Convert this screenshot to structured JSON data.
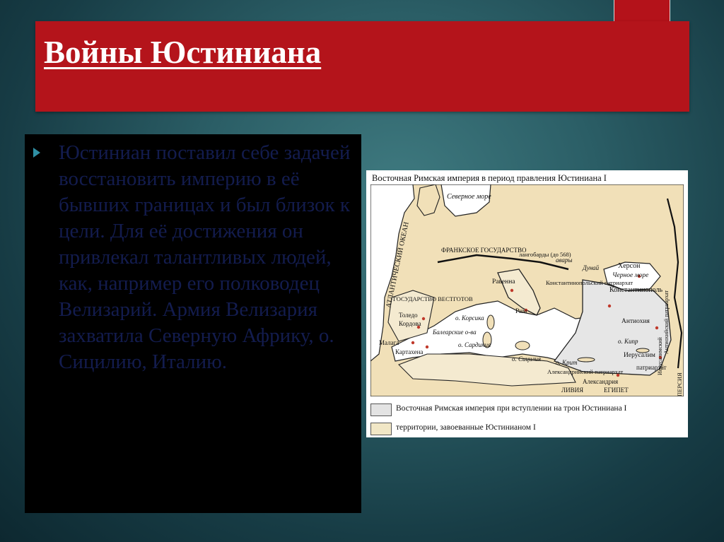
{
  "slide": {
    "title": "Войны Юстиниана",
    "body": "Юстиниан поставил себе задачей восстановить империю в её бывших границах и был близок к цели. Для её достижения он привлекал талантливых людей, как, например его полководец Велизарий. Армия Велизария захватила Северную Африку, о. Сицилию, Италию."
  },
  "map": {
    "caption": "Восточная Римская империя в период правления Юстиниана I",
    "labels": {
      "atlantic": "АТЛАНТИЧЕСКИЙ ОКЕАН",
      "north_sea": "Северное море",
      "frankish": "ФРАНКСКОЕ ГОСУДАРСТВО",
      "lombards": "лангобарды (до 568)",
      "avars": "авары",
      "danube": "Дунай",
      "kherson": "Херсон",
      "black_sea": "Черное море",
      "constantinople_patr": "Константинопольский патриархат",
      "constantinople": "Константинополь",
      "ravenna": "Равенна",
      "rome": "Рим",
      "visigoths": "ГОСУДАРСТВО ВЕСТГОТОВ",
      "toledo": "Толедо",
      "cordoba": "Кордова",
      "corsica": "о. Корсика",
      "balearic": "Балеарские о-ва",
      "sardinia": "о. Сардиния",
      "malaga": "Малага",
      "carthagena": "Картахена",
      "sicily": "о. Сицилия",
      "crete": "о. Крит",
      "antioch": "Антиохия",
      "antioch_patr": "Антиохийский патриархат",
      "cyprus": "о. Кипр",
      "jerusalem_patr_v": "Иерусалимский",
      "jerusalem": "Иерусалим",
      "jerusalem_patr": "патриархат",
      "alexandria_patr": "Александрийский патриархат",
      "alexandria": "Александрия",
      "libya": "ЛИВИЯ",
      "egypt": "ЕГИПЕТ",
      "persia": "ПЕРСИЯ"
    },
    "legend": [
      {
        "text": "Восточная Римская империя при вступлении на трон Юстиниана I",
        "color": "#e3e3e3"
      },
      {
        "text": "территории, завоеванные Юстинианом I",
        "color": "#f1e7c6"
      }
    ],
    "colors": {
      "land": "#f1e0b8",
      "sea": "#ffffff",
      "empire": "#e6e6e6",
      "conquered": "#f4ead0",
      "city": "#c0392b"
    }
  }
}
